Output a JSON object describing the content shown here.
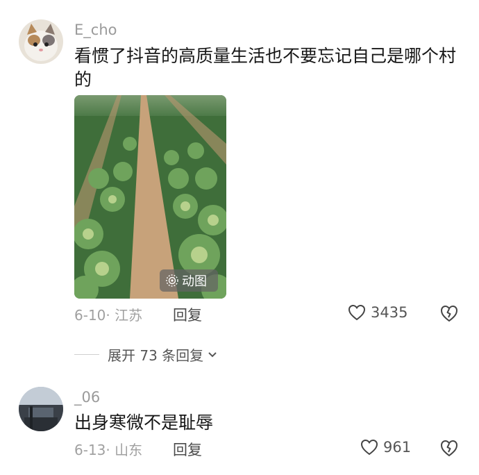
{
  "comments": [
    {
      "username": "E_cho",
      "text": "看惯了抖音的高质量生活也不要忘记自己是哪个村的",
      "gif_label": "动图",
      "meta": "6-10· 江苏",
      "reply_label": "回复",
      "likes": "3435",
      "expand_label": "展开 73 条回复"
    },
    {
      "username": "_06",
      "text": "出身寒微不是耻辱",
      "meta": "6-13· 山东",
      "reply_label": "回复",
      "likes": "961"
    }
  ]
}
